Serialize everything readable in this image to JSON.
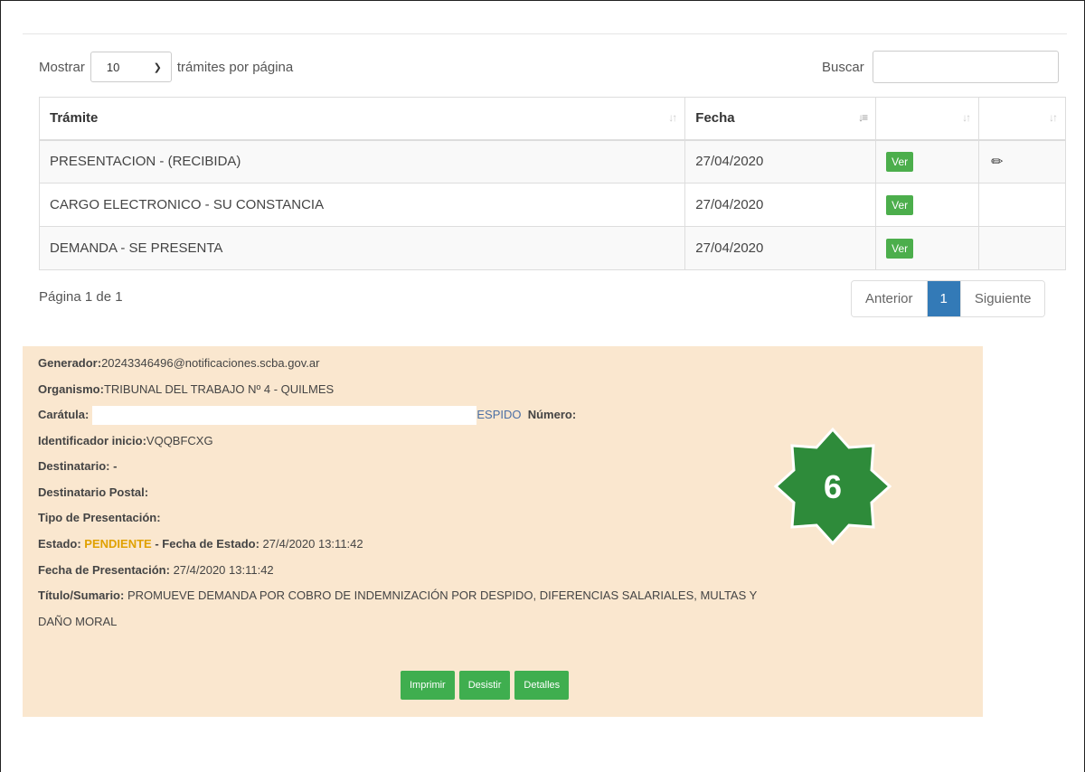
{
  "length_control": {
    "prefix": "Mostrar",
    "selected": "10",
    "suffix": "trámites por página"
  },
  "search": {
    "label": "Buscar",
    "value": ""
  },
  "table": {
    "columns": [
      "Trámite",
      "Fecha",
      "",
      ""
    ],
    "rows": [
      {
        "tramite": "PRESENTACION - (RECIBIDA)",
        "fecha": "27/04/2020",
        "action": "Ver",
        "edit_icon": "pencil-icon"
      },
      {
        "tramite": "CARGO ELECTRONICO - SU CONSTANCIA",
        "fecha": "27/04/2020",
        "action": "Ver"
      },
      {
        "tramite": "DEMANDA - SE PRESENTA",
        "fecha": "27/04/2020",
        "action": "Ver"
      }
    ]
  },
  "pagination": {
    "info": "Página 1 de 1",
    "prev": "Anterior",
    "current": "1",
    "next": "Siguiente"
  },
  "detail": {
    "generador_label": "Generador:",
    "generador_value": "20243346496@notificaciones.scba.gov.ar",
    "organismo_label": "Organismo:",
    "organismo_value": "TRIBUNAL DEL TRABAJO Nº 4 - QUILMES",
    "caratula_label": "Carátula:",
    "caratula_tail": "ESPIDO",
    "numero_label": "Número:",
    "identificador_label": "Identificador inicio:",
    "identificador_value": "VQQBFCXG",
    "destinatario_label": "Destinatario: -",
    "destinatario_postal_label": "Destinatario Postal:",
    "tipo_label": "Tipo de Presentación:",
    "estado_label": "Estado:",
    "estado_value": "PENDIENTE",
    "fecha_estado_label": "- Fecha de Estado:",
    "fecha_estado_value": "27/4/2020 13:11:42",
    "fecha_presentacion_label": "Fecha de Presentación:",
    "fecha_presentacion_value": "27/4/2020 13:11:42",
    "titulo_label": "Título/Sumario:",
    "titulo_value_line1": "PROMUEVE DEMANDA POR COBRO DE INDEMNIZACIÓN POR DESPIDO, DIFERENCIAS SALARIALES, MULTAS Y",
    "titulo_value_line2": "DAÑO MORAL",
    "buttons": [
      "Imprimir",
      "Desistir",
      "Detalles"
    ]
  },
  "step_badge": {
    "number": "6",
    "color": "#2e8b3a"
  },
  "colors": {
    "ver_button": "#4cae4c",
    "card_background": "#fae7cf",
    "estado_pendiente": "#e0a100",
    "pager_active": "#337ab7"
  }
}
